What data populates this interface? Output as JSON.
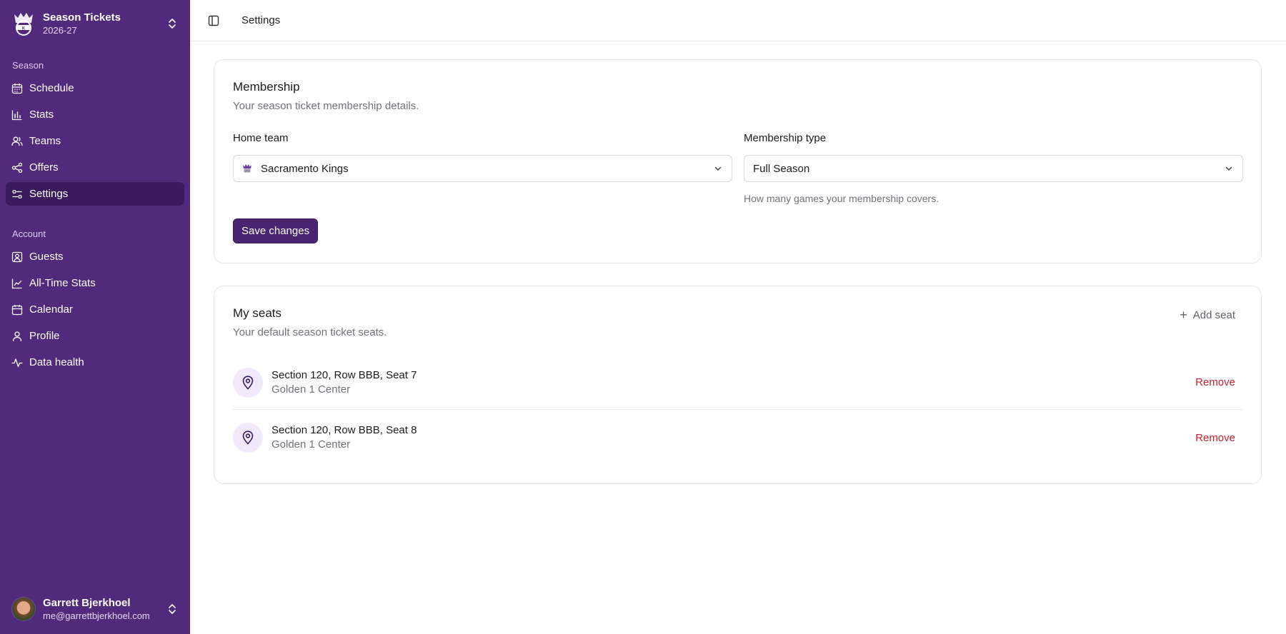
{
  "brand": {
    "title": "Season Tickets",
    "subtitle": "2026-27"
  },
  "sidebar": {
    "season_label": "Season",
    "season_items": [
      {
        "label": "Schedule",
        "icon": "calendar-grid-icon"
      },
      {
        "label": "Stats",
        "icon": "bar-chart-icon"
      },
      {
        "label": "Teams",
        "icon": "users-icon"
      },
      {
        "label": "Offers",
        "icon": "share-icon"
      },
      {
        "label": "Settings",
        "icon": "sliders-icon",
        "active": true
      }
    ],
    "account_label": "Account",
    "account_items": [
      {
        "label": "Guests",
        "icon": "contact-icon"
      },
      {
        "label": "All-Time Stats",
        "icon": "line-chart-icon"
      },
      {
        "label": "Calendar",
        "icon": "calendar-icon"
      },
      {
        "label": "Profile",
        "icon": "user-icon"
      },
      {
        "label": "Data health",
        "icon": "activity-icon"
      }
    ]
  },
  "user": {
    "name": "Garrett Bjerkhoel",
    "email": "me@garrettbjerkhoel.com"
  },
  "topbar": {
    "title": "Settings"
  },
  "membership": {
    "title": "Membership",
    "description": "Your season ticket membership details.",
    "home_team_label": "Home team",
    "home_team_value": "Sacramento Kings",
    "type_label": "Membership type",
    "type_value": "Full Season",
    "type_hint": "How many games your membership covers.",
    "save_label": "Save changes"
  },
  "seats": {
    "title": "My seats",
    "description": "Your default season ticket seats.",
    "add_label": "Add seat",
    "remove_label": "Remove",
    "items": [
      {
        "title": "Section 120, Row BBB, Seat 7",
        "venue": "Golden 1 Center"
      },
      {
        "title": "Section 120, Row BBB, Seat 8",
        "venue": "Golden 1 Center"
      }
    ]
  },
  "colors": {
    "sidebar": "#522a7c",
    "active_item": "#3a1a5c",
    "primary_button": "#4a2470",
    "danger": "#c8202f"
  }
}
